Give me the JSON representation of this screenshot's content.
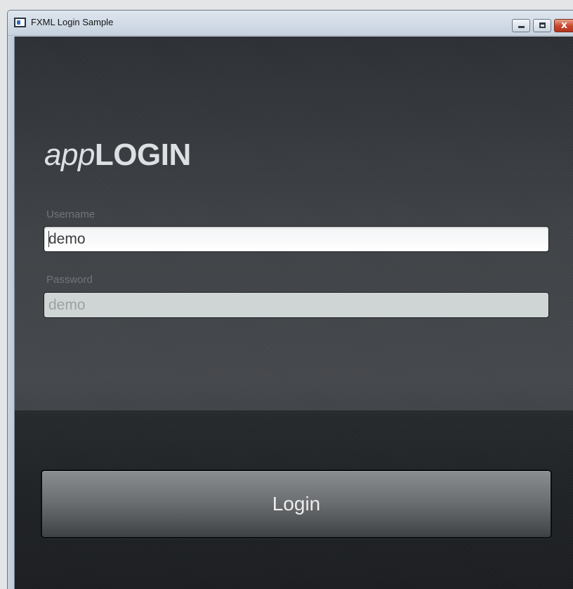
{
  "window": {
    "title": "FXML Login Sample",
    "controls": {
      "minimize_icon": "minimize-icon",
      "maximize_icon": "maximize-icon",
      "close_icon": "close-icon",
      "close_glyph": "x"
    }
  },
  "logo": {
    "prefix": "app",
    "suffix": "LOGIN"
  },
  "form": {
    "username": {
      "label": "Username",
      "value": "demo"
    },
    "password": {
      "label": "Password",
      "value": "demo"
    },
    "login_label": "Login"
  },
  "colors": {
    "background": "#3b3e42",
    "panel": "#1f2225",
    "text_light": "#dde0e3",
    "label_muted": "#717579",
    "close_button": "#c9452a"
  }
}
